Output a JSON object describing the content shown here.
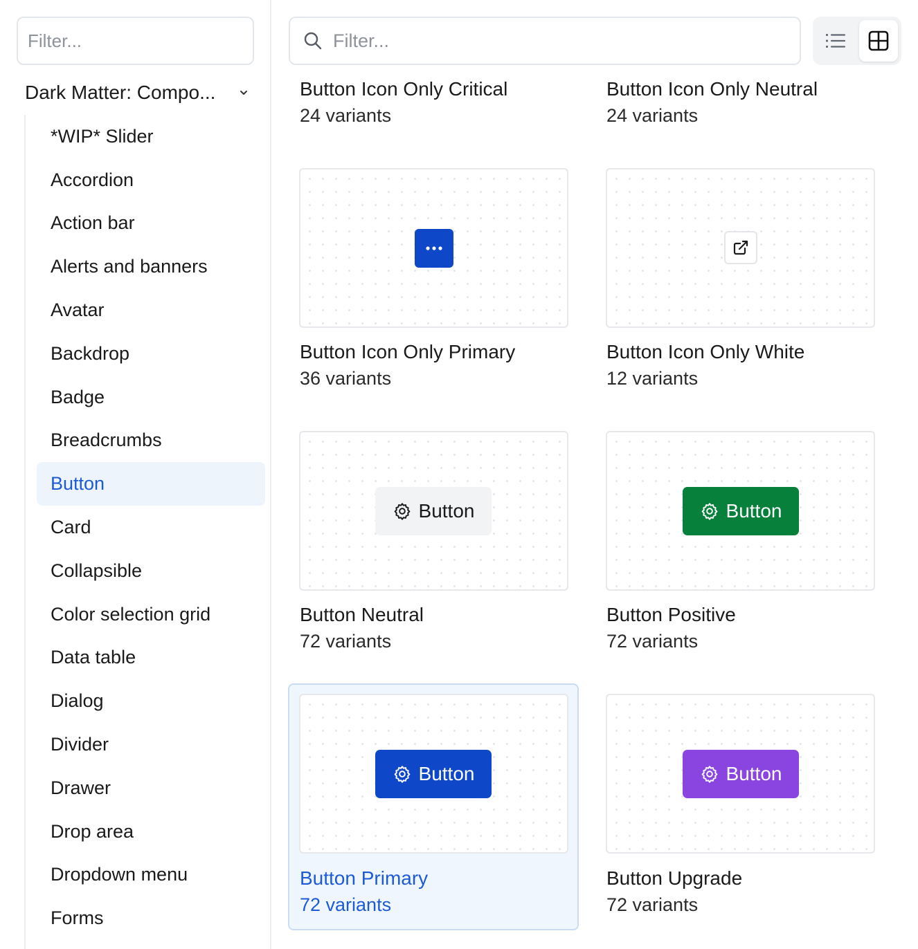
{
  "sidebar": {
    "filter_placeholder": "Filter...",
    "library_title": "Dark Matter: Compo...",
    "items": [
      {
        "label": "*WIP* Slider"
      },
      {
        "label": "Accordion"
      },
      {
        "label": "Action bar"
      },
      {
        "label": "Alerts and banners"
      },
      {
        "label": "Avatar"
      },
      {
        "label": "Backdrop"
      },
      {
        "label": "Badge"
      },
      {
        "label": "Breadcrumbs"
      },
      {
        "label": "Button",
        "active": true
      },
      {
        "label": "Card"
      },
      {
        "label": "Collapsible"
      },
      {
        "label": "Color selection grid"
      },
      {
        "label": "Data table"
      },
      {
        "label": "Dialog"
      },
      {
        "label": "Divider"
      },
      {
        "label": "Drawer"
      },
      {
        "label": "Drop area"
      },
      {
        "label": "Dropdown menu"
      },
      {
        "label": "Forms"
      }
    ]
  },
  "main": {
    "filter_placeholder": "Filter...",
    "view_toggle": {
      "active": "grid",
      "options": [
        "list-icon",
        "grid-icon"
      ]
    },
    "components": [
      {
        "title": "Button Icon Only Critical",
        "variants": "24 variants"
      },
      {
        "title": "Button Icon Only Neutral",
        "variants": "24 variants"
      },
      {
        "title": "Button Icon Only Primary",
        "variants": "36 variants",
        "preview": "more-horizontal-icon"
      },
      {
        "title": "Button Icon Only White",
        "variants": "12 variants",
        "preview": "external-link-icon"
      },
      {
        "title": "Button Neutral",
        "variants": "72 variants",
        "preview_label": "Button"
      },
      {
        "title": "Button Positive",
        "variants": "72 variants",
        "preview_label": "Button"
      },
      {
        "title": "Button Primary",
        "variants": "72 variants",
        "preview_label": "Button",
        "selected": true
      },
      {
        "title": "Button Upgrade",
        "variants": "72 variants",
        "preview_label": "Button"
      }
    ]
  },
  "colors": {
    "accent": "#1d5bd6",
    "primary_button": "#0f47c9",
    "positive_button": "#06803b",
    "upgrade_button": "#8a44e0",
    "neutral_button": "#f2f3f4"
  }
}
